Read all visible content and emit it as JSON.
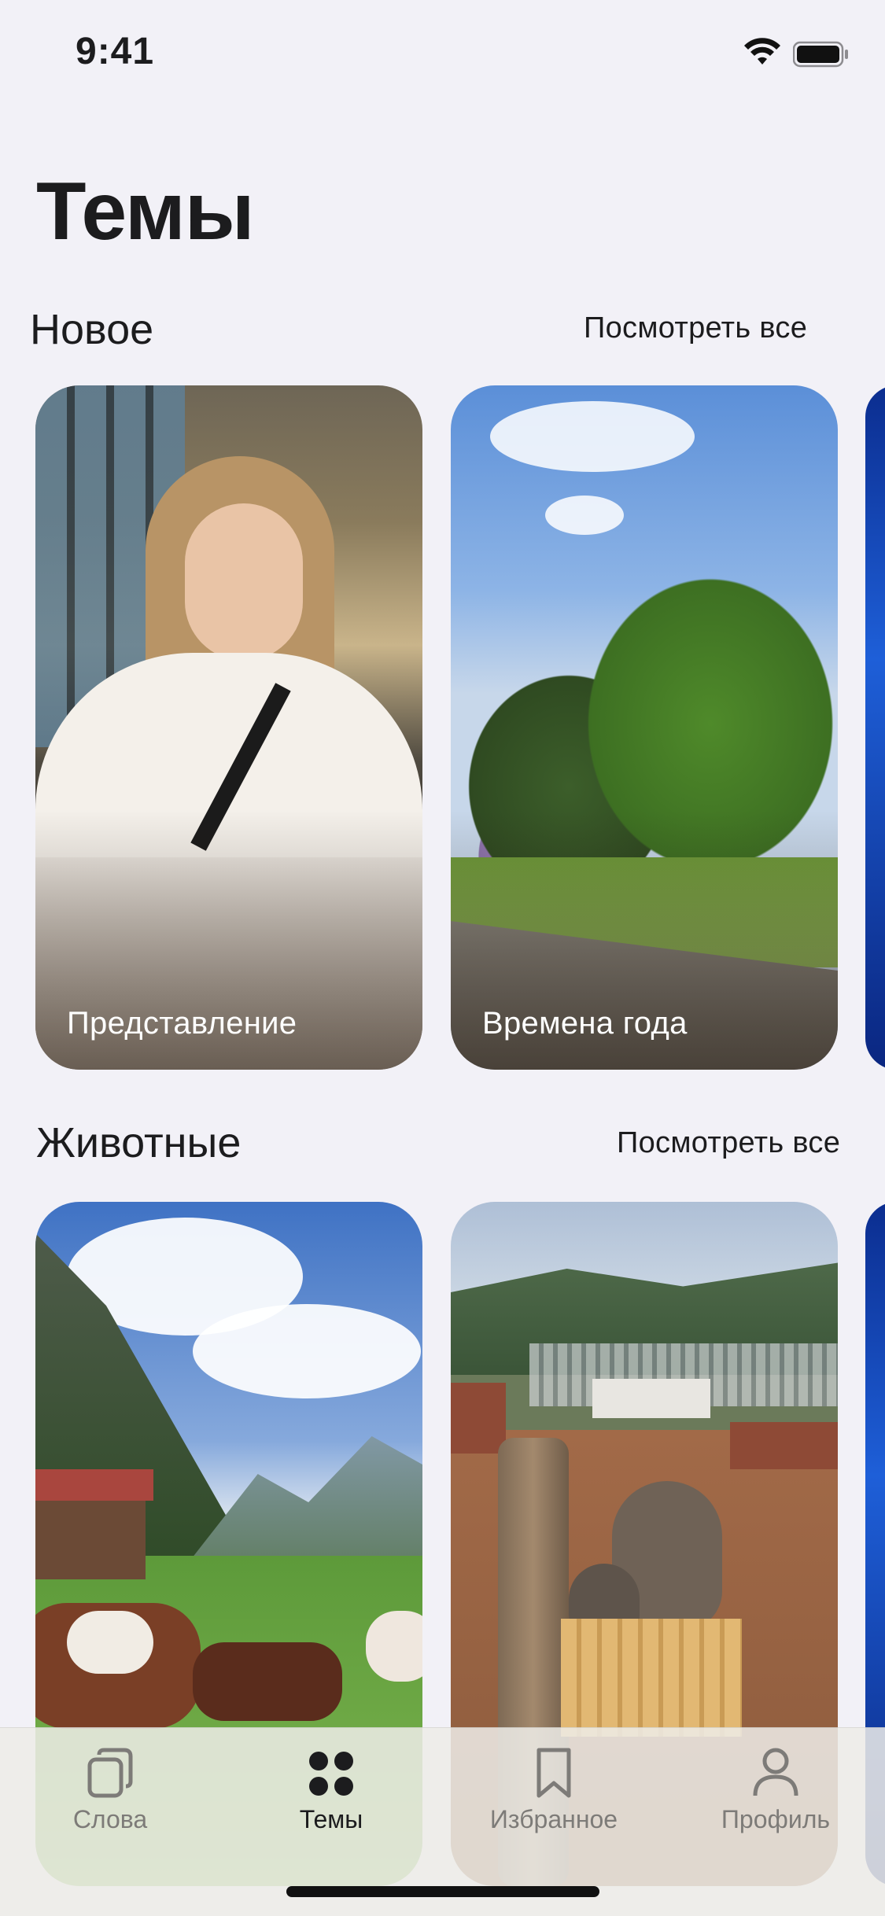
{
  "status_bar": {
    "time": "9:41"
  },
  "page": {
    "title": "Темы"
  },
  "sections": [
    {
      "title": "Новое",
      "see_all": "Посмотреть все",
      "cards": [
        {
          "label": "Представление"
        },
        {
          "label": "Времена года"
        }
      ]
    },
    {
      "title": "Животные",
      "see_all": "Посмотреть все",
      "cards": [
        {
          "label": ""
        },
        {
          "label": ""
        }
      ]
    }
  ],
  "tab_bar": {
    "items": [
      {
        "label": "Слова",
        "icon": "cards-stack-icon",
        "active": false
      },
      {
        "label": "Темы",
        "icon": "four-dots-grid-icon",
        "active": true
      },
      {
        "label": "Избранное",
        "icon": "bookmark-icon",
        "active": false
      },
      {
        "label": "Профиль",
        "icon": "person-icon",
        "active": false
      }
    ]
  },
  "colors": {
    "background": "#f2f1f7",
    "text": "#1c1c1e",
    "inactive_tab": "#7d7b78"
  }
}
